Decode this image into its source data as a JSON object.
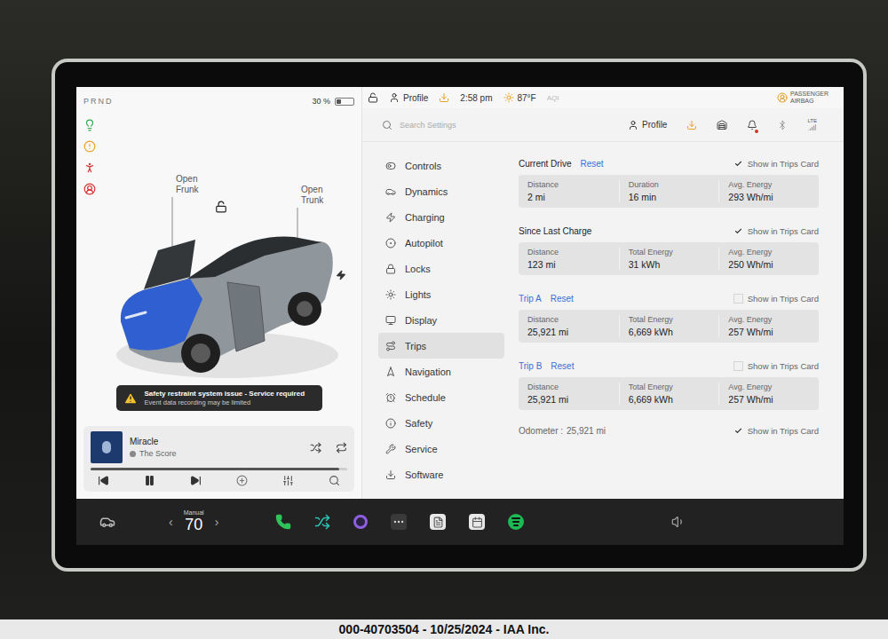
{
  "gear": "PRND",
  "battery": {
    "reading": "30 %",
    "level": 0.3
  },
  "indicators": [
    {
      "kind": "headlights",
      "color": "#2fa84f"
    },
    {
      "kind": "tpms",
      "color": "#e8a020"
    },
    {
      "kind": "seatbelt",
      "color": "#d9302c"
    },
    {
      "kind": "airbag",
      "color": "#d9302c"
    }
  ],
  "car": {
    "frunk_label": "Open Frunk",
    "trunk_label": "Open Trunk",
    "locked": false,
    "frunk_open": true,
    "door_open": true
  },
  "alert": {
    "title": "Safety restraint system issue - Service required",
    "detail": "Event data recording may be limited"
  },
  "media": {
    "title": "Miracle",
    "artist": "The Score",
    "level": 0.97,
    "playing": true
  },
  "status_bar": {
    "locked": false,
    "profile": "Profile",
    "time": "2:58 pm",
    "temperature": "87°F",
    "aqi": "AQI",
    "airbag": "PASSENGER AIRBAG"
  },
  "settings_header": {
    "search_placeholder": "Search Settings",
    "profile": "Profile",
    "network": "LTE"
  },
  "sidebar": {
    "items": [
      {
        "label": "Controls",
        "selected": false
      },
      {
        "label": "Dynamics",
        "selected": false
      },
      {
        "label": "Charging",
        "selected": false
      },
      {
        "label": "Autopilot",
        "selected": false
      },
      {
        "label": "Locks",
        "selected": false
      },
      {
        "label": "Lights",
        "selected": false
      },
      {
        "label": "Display",
        "selected": false
      },
      {
        "label": "Trips",
        "selected": true
      },
      {
        "label": "Navigation",
        "selected": false
      },
      {
        "label": "Schedule",
        "selected": false
      },
      {
        "label": "Safety",
        "selected": false
      },
      {
        "label": "Service",
        "selected": false
      },
      {
        "label": "Software",
        "selected": false
      }
    ]
  },
  "trips": [
    {
      "title": "Current Drive",
      "link": false,
      "reset": "Reset",
      "show_label": "Show in Trips Card",
      "checked": true,
      "fields": [
        {
          "label": "Distance",
          "value": "2 mi"
        },
        {
          "label": "Duration",
          "value": "16 min"
        },
        {
          "label": "Avg. Energy",
          "value": "293 Wh/mi"
        }
      ]
    },
    {
      "title": "Since Last Charge",
      "link": false,
      "show_label": "Show in Trips Card",
      "checked": true,
      "fields": [
        {
          "label": "Distance",
          "value": "123 mi"
        },
        {
          "label": "Total Energy",
          "value": "31 kWh"
        },
        {
          "label": "Avg. Energy",
          "value": "250 Wh/mi"
        }
      ]
    },
    {
      "title": "Trip A",
      "link": true,
      "reset": "Reset",
      "show_label": "Show in Trips Card",
      "checked": false,
      "fields": [
        {
          "label": "Distance",
          "value": "25,921 mi"
        },
        {
          "label": "Total Energy",
          "value": "6,669 kWh"
        },
        {
          "label": "Avg. Energy",
          "value": "257 Wh/mi"
        }
      ]
    },
    {
      "title": "Trip B",
      "link": true,
      "reset": "Reset",
      "show_label": "Show in Trips Card",
      "checked": false,
      "fields": [
        {
          "label": "Distance",
          "value": "25,921 mi"
        },
        {
          "label": "Total Energy",
          "value": "6,669 kWh"
        },
        {
          "label": "Avg. Energy",
          "value": "257 Wh/mi"
        }
      ]
    }
  ],
  "odometer": {
    "label": "Odometer :",
    "value": "25,921 mi",
    "show_label": "Show in Trips Card",
    "checked": true
  },
  "dock": {
    "climate_label": "Manual",
    "temperature": "70",
    "left": "‹",
    "right": "›"
  },
  "caption": "000-40703504 - 10/25/2024 - IAA Inc."
}
